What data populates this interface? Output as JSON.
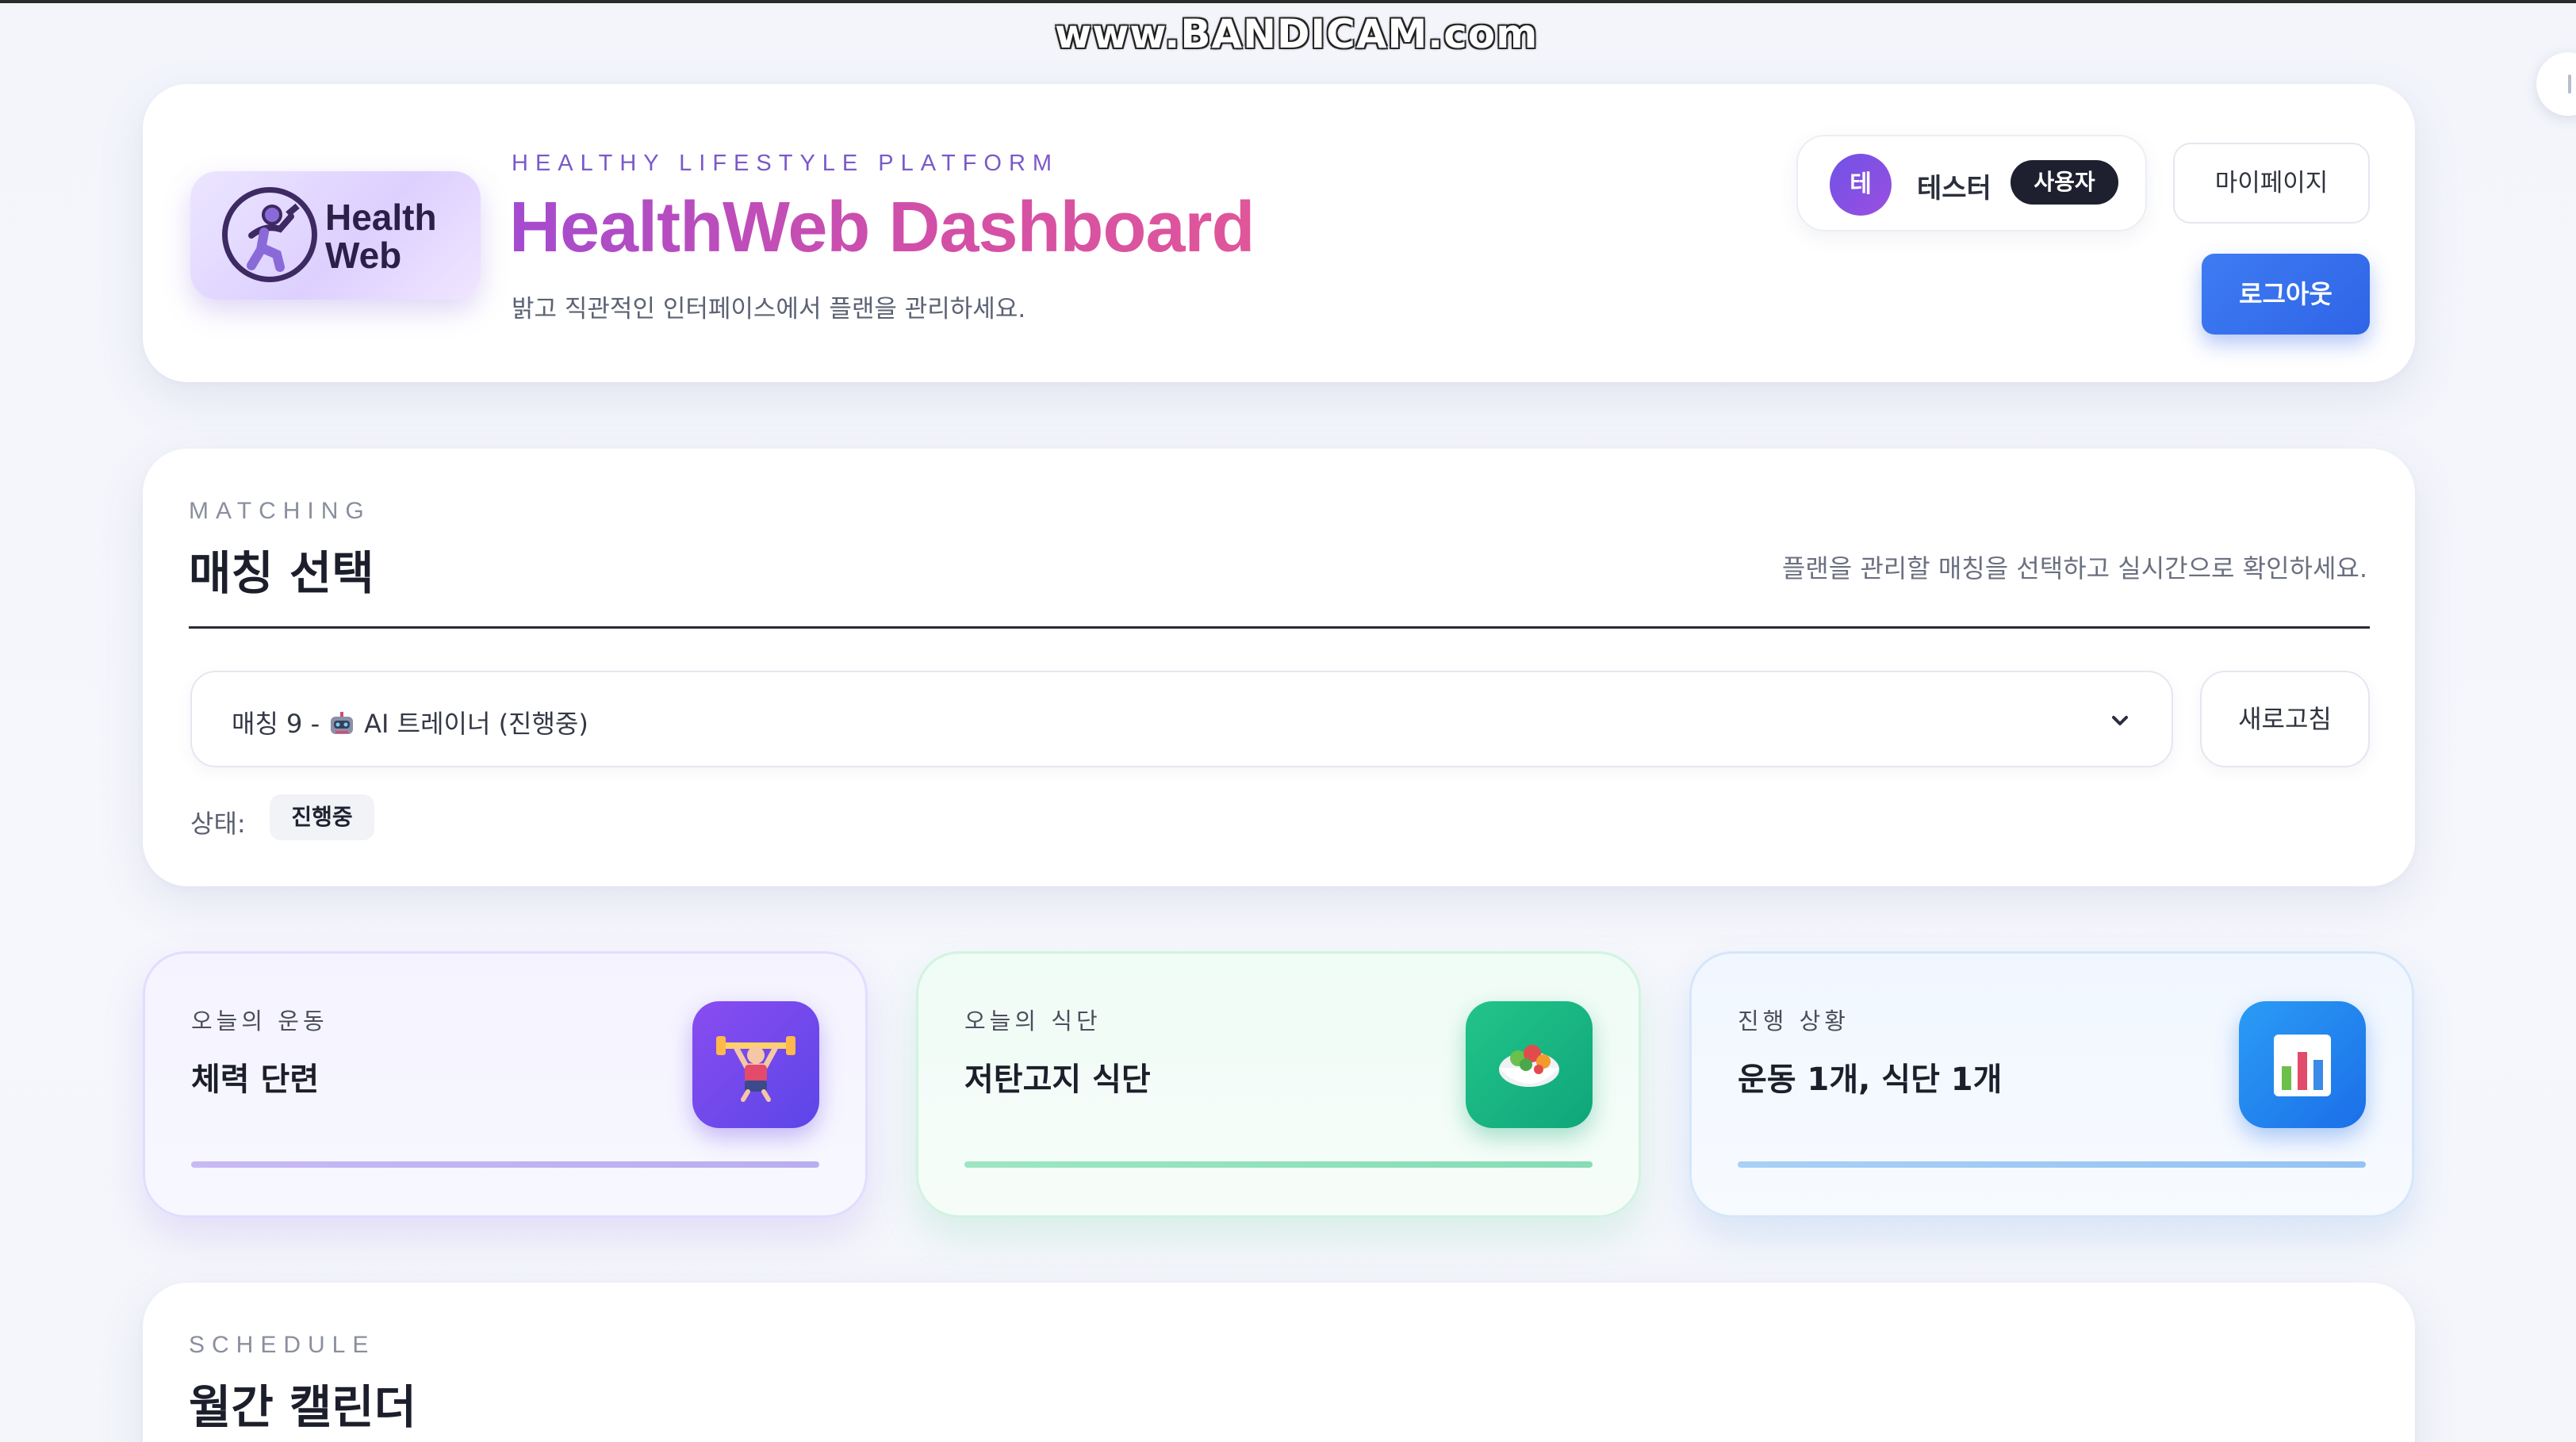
{
  "watermark": "www.BANDICAM.com",
  "header": {
    "logo_line1": "Health",
    "logo_line2": "Web",
    "kicker": "HEALTHY LIFESTYLE PLATFORM",
    "title": "HealthWeb Dashboard",
    "subtitle": "밝고 직관적인 인터페이스에서 플랜을 관리하세요.",
    "user": {
      "avatar_initial": "테",
      "name": "테스터",
      "role": "사용자"
    },
    "mypage_label": "마이페이지",
    "logout_label": "로그아웃"
  },
  "matching": {
    "kicker": "MATCHING",
    "title": "매칭 선택",
    "description": "플랜을 관리할 매칭을 선택하고 실시간으로 확인하세요.",
    "select_prefix": "매칭 9 -",
    "select_value": "AI 트레이너 (진행중)",
    "refresh_label": "새로고침",
    "status_label": "상태:",
    "status_value": "진행중"
  },
  "stats": [
    {
      "kicker": "오늘의 운동",
      "value": "체력 단련",
      "icon": "weightlifter-icon"
    },
    {
      "kicker": "오늘의 식단",
      "value": "저탄고지 식단",
      "icon": "salad-bowl-icon"
    },
    {
      "kicker": "진행 상황",
      "value": "운동 1개, 식단 1개",
      "icon": "bar-chart-icon"
    }
  ],
  "schedule": {
    "kicker": "SCHEDULE",
    "title": "월간 캘린더"
  },
  "colors": {
    "accent_purple": "#7a5ac8",
    "title_gradient_start": "#a44bd0",
    "title_gradient_end": "#e0569a",
    "logout_blue": "#2f64e6",
    "green": "#0fa67a",
    "blue": "#1c6fe8"
  }
}
